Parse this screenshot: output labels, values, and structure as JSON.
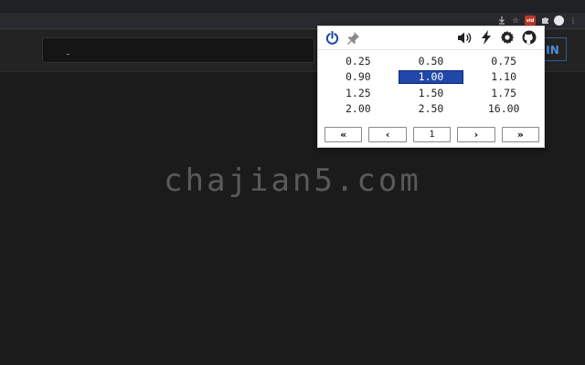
{
  "watermark": "chajian5.com",
  "page": {
    "signin_label": "IN"
  },
  "toolbar": {
    "ext_badge": "vid"
  },
  "popup": {
    "speeds": [
      [
        "0.25",
        "0.50",
        "0.75"
      ],
      [
        "0.90",
        "1.00",
        "1.10"
      ],
      [
        "1.25",
        "1.50",
        "1.75"
      ],
      [
        "2.00",
        "2.50",
        "16.00"
      ]
    ],
    "active_speed": "1.00",
    "pager": {
      "first": "«",
      "prev": "‹",
      "page": "1",
      "next": "›",
      "last": "»"
    }
  },
  "colors": {
    "accent": "#2148a8",
    "power": "#2148a8",
    "signin": "#4a90e2"
  }
}
